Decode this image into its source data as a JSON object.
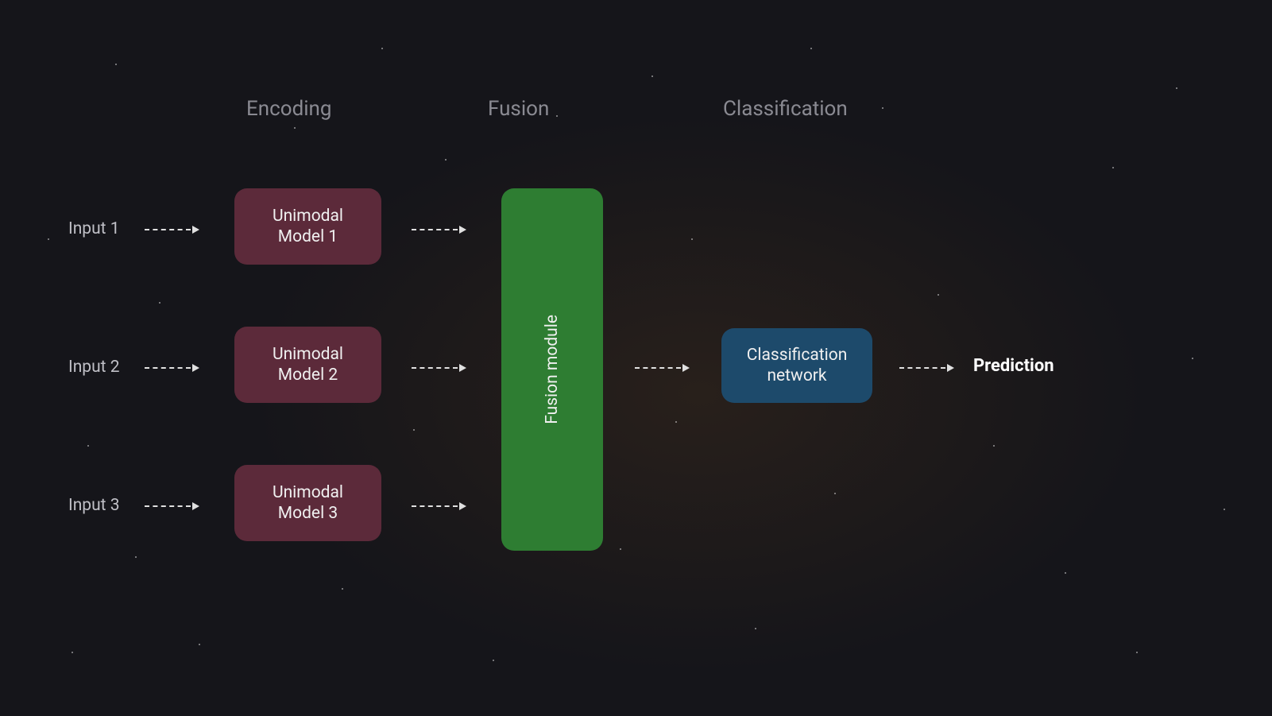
{
  "stages": {
    "encoding": "Encoding",
    "fusion": "Fusion",
    "classification": "Classification"
  },
  "inputs": [
    "Input 1",
    "Input 2",
    "Input 3"
  ],
  "encoders": [
    "Unimodal\nModel 1",
    "Unimodal\nModel 2",
    "Unimodal\nModel 3"
  ],
  "fusion_module": "Fusion module",
  "classification_network": "Classification\nnetwork",
  "output": "Prediction",
  "colors": {
    "encoder": "#5c2a3a",
    "fusion": "#2e7d32",
    "classification": "#1d4a6b",
    "stage_label": "#8a8a92",
    "text": "#e8e8e8"
  }
}
